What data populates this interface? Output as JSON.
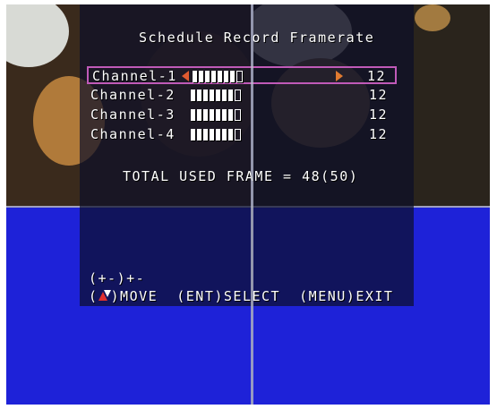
{
  "title": "Schedule Record Framerate",
  "channels": [
    {
      "label": "Channel-1",
      "value": "12",
      "selected": true,
      "level": 0.8
    },
    {
      "label": "Channel-2",
      "value": "12",
      "selected": false,
      "level": 0.8
    },
    {
      "label": "Channel-3",
      "value": "12",
      "selected": false,
      "level": 0.8
    },
    {
      "label": "Channel-4",
      "value": "12",
      "selected": false,
      "level": 0.8
    }
  ],
  "total": "TOTAL USED FRAME = 48(50)",
  "hint": "(+-)+-",
  "nav": {
    "move_open": "(",
    "move": ")MOVE",
    "select": "(ENT)SELECT",
    "exit": "(MENU)EXIT"
  },
  "colors": {
    "selection_border": "#c05ab8",
    "arrow": "#e05a30",
    "background_blue": "#1e22d8"
  }
}
